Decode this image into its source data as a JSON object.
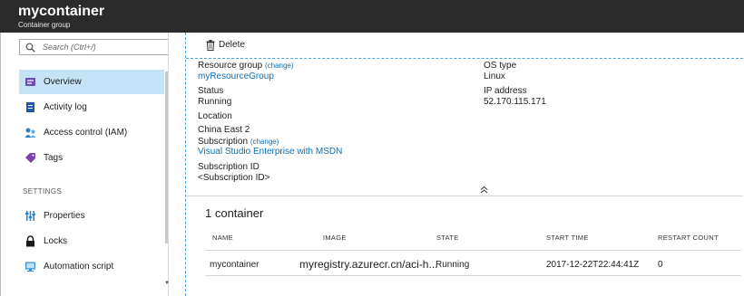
{
  "header": {
    "title": "mycontainer",
    "subtitle": "Container group"
  },
  "search": {
    "placeholder": "Search (Ctrl+/)"
  },
  "sidebar": {
    "items": [
      {
        "label": "Overview",
        "icon": "overview-icon",
        "active": true
      },
      {
        "label": "Activity log",
        "icon": "activity-log-icon"
      },
      {
        "label": "Access control (IAM)",
        "icon": "access-control-icon"
      },
      {
        "label": "Tags",
        "icon": "tag-icon"
      }
    ],
    "section": "SETTINGS",
    "settings_items": [
      {
        "label": "Properties",
        "icon": "properties-icon"
      },
      {
        "label": "Locks",
        "icon": "lock-icon"
      },
      {
        "label": "Automation script",
        "icon": "automation-script-icon"
      }
    ]
  },
  "toolbar": {
    "delete_label": "Delete"
  },
  "essentials": {
    "resource_group": {
      "label": "Resource group",
      "change": "(change)",
      "value": "myResourceGroup"
    },
    "status": {
      "label": "Status",
      "value": "Running"
    },
    "location": {
      "label": "Location",
      "value": "China East 2"
    },
    "subscription": {
      "label": "Subscription",
      "change": "(change)",
      "value": "Visual Studio Enterprise with MSDN"
    },
    "subscription_id": {
      "label": "Subscription ID",
      "value": "<Subscription ID>"
    },
    "os_type": {
      "label": "OS type",
      "value": "Linux"
    },
    "ip_address": {
      "label": "IP address",
      "value": "52.170.115.171"
    }
  },
  "containers": {
    "count_label": "1 container",
    "columns": [
      "NAME",
      "IMAGE",
      "STATE",
      "START TIME",
      "RESTART COUNT"
    ],
    "rows": [
      {
        "name": "mycontainer",
        "image": "myregistry.azurecr.cn/aci-h...",
        "state": "Running",
        "start_time": "2017-12-22T22:44:41Z",
        "restart_count": "0"
      }
    ]
  },
  "colors": {
    "accent": "#0a6fb8",
    "active_bg": "#c4e3f7",
    "header_bg": "#2b2b2b"
  }
}
